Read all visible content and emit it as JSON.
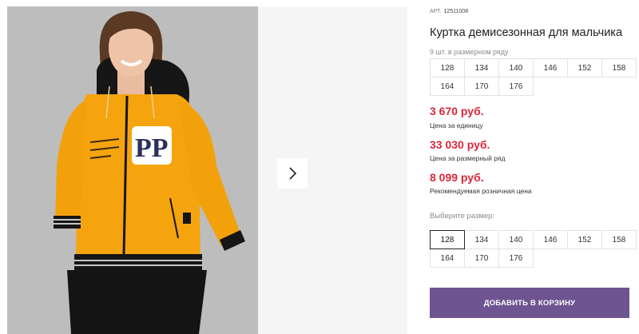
{
  "product": {
    "sku_label": "АРТ.",
    "sku_value": "12511008",
    "title": "Куртка демисезонная для мальчика",
    "pack_note": "9 шт. в размерном ряду",
    "pack_sizes": [
      "128",
      "134",
      "140",
      "146",
      "152",
      "158",
      "164",
      "170",
      "176"
    ]
  },
  "prices": {
    "unit_price": "3 670 руб.",
    "unit_label": "Цена за единицу",
    "pack_price": "33 030 руб.",
    "pack_label": "Цена за размерный ряд",
    "retail_price": "8 099 руб.",
    "retail_label": "Рекомендуемая розничная цена"
  },
  "size_picker": {
    "label": "Выберите размер:",
    "selected": "128",
    "options": [
      "128",
      "134",
      "140",
      "146",
      "152",
      "158",
      "164",
      "170",
      "176"
    ]
  },
  "actions": {
    "add_to_cart": "ДОБАВИТЬ В КОРЗИНУ"
  },
  "gallery": {
    "next_icon": "chevron-right-icon"
  },
  "colors": {
    "price_red": "#d8283c",
    "button_purple": "#6e5591",
    "jacket_orange": "#f5a40e"
  }
}
